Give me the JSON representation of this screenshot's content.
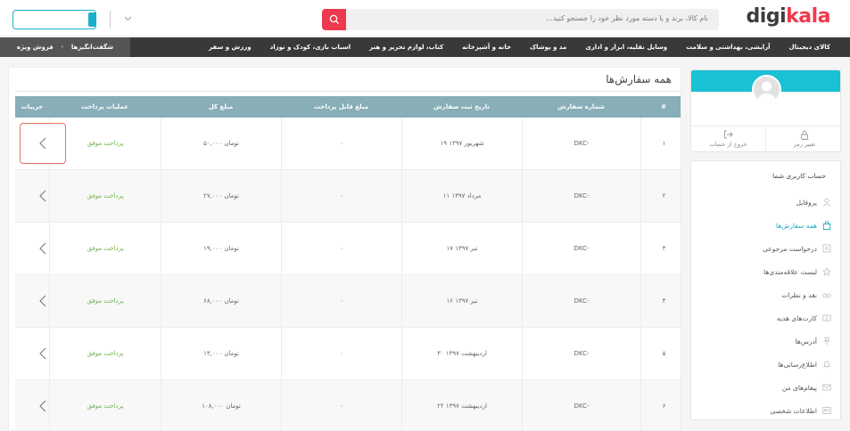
{
  "header": {
    "logo_main": "digi",
    "logo_accent": "kala",
    "search_placeholder": "نام کالا، برند و یا دسته مورد نظر خود را جستجو کنید…"
  },
  "nav": {
    "items": [
      "کالای دیجیتال",
      "آرایشی، بهداشتی و سلامت",
      "وسایل نقلیه، ابزار و اداری",
      "مد و پوشاک",
      "خانه و آشپزخانه",
      "کتاب، لوازم تحریر و هنر",
      "اسباب بازی، کودک و نوزاد",
      "ورزش و سفر"
    ],
    "special_1": "فروش ویژه",
    "special_2": "شگفت‌انگیزها"
  },
  "main": {
    "title": "همه سفارش‌ها",
    "columns": [
      "#",
      "شماره سفارش",
      "تاریخ ثبت سفارش",
      "مبلغ قابل پرداخت",
      "مبلغ کل",
      "عملیات پرداخت",
      "جزییات"
    ],
    "rows": [
      {
        "index": "۱",
        "order": "DKC-",
        "date": "۱۹ شهریور ۱۳۹۷",
        "payable": "۰",
        "total": "۵۰,۰۰۰ تومان",
        "status": "پرداخت موفق"
      },
      {
        "index": "۲",
        "order": "DKC-",
        "date": "۱۱ مرداد ۱۳۹۷",
        "payable": "۰",
        "total": "۲۷,۰۰۰ تومان",
        "status": "پرداخت موفق"
      },
      {
        "index": "۳",
        "order": "DKC-",
        "date": "۱۷ تیر ۱۳۹۷",
        "payable": "۰",
        "total": "۱۹,۰۰۰ تومان",
        "status": "پرداخت موفق"
      },
      {
        "index": "۴",
        "order": "DKC-",
        "date": "۱۶ تیر ۱۳۹۷",
        "payable": "۰",
        "total": "۶۸,۰۰۰ تومان",
        "status": "پرداخت موفق"
      },
      {
        "index": "۵",
        "order": "DKC-",
        "date": "۳۰ اردیبهشت ۱۳۹۷",
        "payable": "۰",
        "total": "۱۳,۰۰۰ تومان",
        "status": "پرداخت موفق"
      },
      {
        "index": "۶",
        "order": "DKC-",
        "date": "۲۲ اردیبهشت ۱۳۹۷",
        "payable": "۰",
        "total": "۱۰۸,۰۰۰ تومان",
        "status": "پرداخت موفق"
      }
    ]
  },
  "sidebar": {
    "change_password": "تغییر رمز",
    "logout": "خروج از حساب",
    "account_title": "حساب کاربری شما",
    "menu": [
      {
        "label": "پروفایل",
        "icon": "user-icon",
        "active": false
      },
      {
        "label": "همه سفارش‌ها",
        "icon": "bag-icon",
        "active": true
      },
      {
        "label": "درخواست مرجوعی",
        "icon": "return-icon",
        "active": false
      },
      {
        "label": "لیست علاقه‌مندی‌ها",
        "icon": "star-icon",
        "active": false
      },
      {
        "label": "نقد و نظرات",
        "icon": "glasses-icon",
        "active": false
      },
      {
        "label": "کارت‌های هدیه",
        "icon": "gift-card-icon",
        "active": false
      },
      {
        "label": "آدرس‌ها",
        "icon": "pin-icon",
        "active": false
      },
      {
        "label": "اطلاع‌رسانی‌ها",
        "icon": "bell-icon",
        "active": false
      },
      {
        "label": "پیغام‌های من",
        "icon": "mail-icon",
        "active": false
      },
      {
        "label": "اطلاعات شخصی",
        "icon": "id-card-icon",
        "active": false
      }
    ]
  },
  "colors": {
    "brand": "#ef394e",
    "accent": "#19c1d4",
    "table_header": "#88aeb8",
    "success": "#6cb347"
  }
}
